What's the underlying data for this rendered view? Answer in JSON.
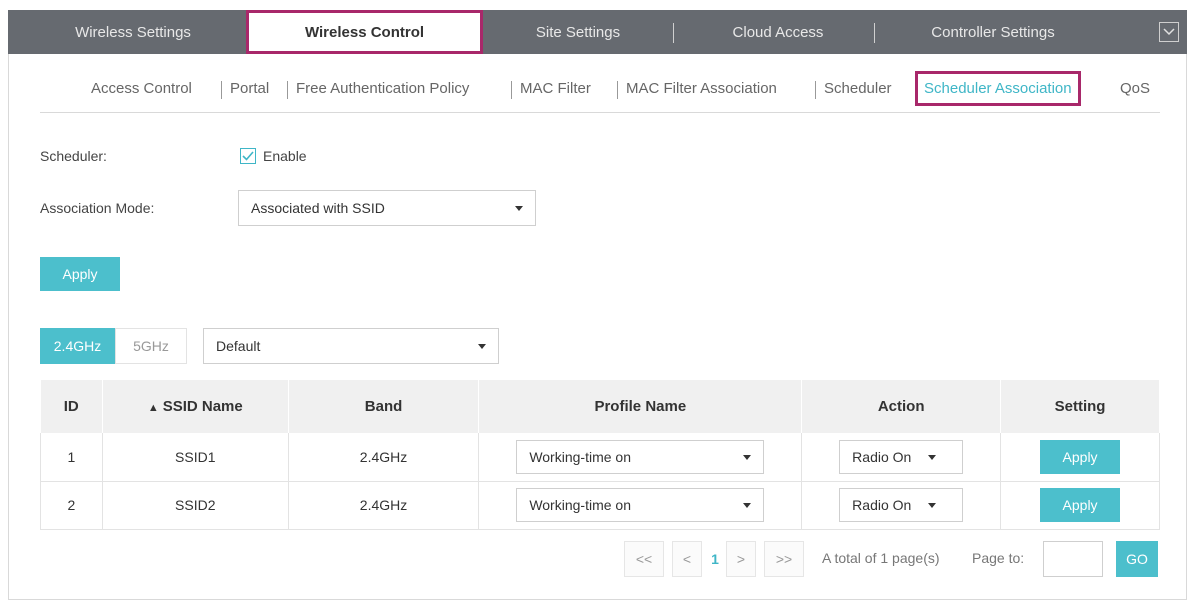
{
  "top_tabs": [
    {
      "label": "Wireless Settings"
    },
    {
      "label": "Wireless Control",
      "active": true
    },
    {
      "label": "Site Settings"
    },
    {
      "label": "Cloud Access"
    },
    {
      "label": "Controller Settings"
    }
  ],
  "sub_tabs": [
    {
      "label": "Access Control"
    },
    {
      "label": "Portal"
    },
    {
      "label": "Free Authentication Policy"
    },
    {
      "label": "MAC Filter"
    },
    {
      "label": "MAC Filter Association"
    },
    {
      "label": "Scheduler"
    },
    {
      "label": "Scheduler Association",
      "active": true
    },
    {
      "label": "QoS"
    }
  ],
  "form": {
    "scheduler_label": "Scheduler:",
    "enable_label": "Enable",
    "enable_checked": true,
    "mode_label": "Association Mode:",
    "mode_value": "Associated with SSID",
    "apply_label": "Apply"
  },
  "band_tabs": [
    {
      "label": "2.4GHz",
      "active": true
    },
    {
      "label": "5GHz",
      "active": false
    }
  ],
  "group_select": "Default",
  "table": {
    "headers": [
      "ID",
      "SSID Name",
      "Band",
      "Profile Name",
      "Action",
      "Setting"
    ],
    "sort_icon": "sort-icon",
    "rows": [
      {
        "id": "1",
        "ssid": "SSID1",
        "band": "2.4GHz",
        "profile": "Working-time on",
        "action": "Radio On",
        "setting": "Apply"
      },
      {
        "id": "2",
        "ssid": "SSID2",
        "band": "2.4GHz",
        "profile": "Working-time on",
        "action": "Radio On",
        "setting": "Apply"
      }
    ]
  },
  "pagination": {
    "first": "<<",
    "prev": "<",
    "current": "1",
    "next": ">",
    "last": ">>",
    "total_text": "A total of 1 page(s)",
    "page_to_label": "Page to:",
    "go_label": "GO"
  },
  "colors": {
    "accent": "#4cbfcc",
    "highlight_border": "#a8286a",
    "topbar": "#666a70"
  }
}
